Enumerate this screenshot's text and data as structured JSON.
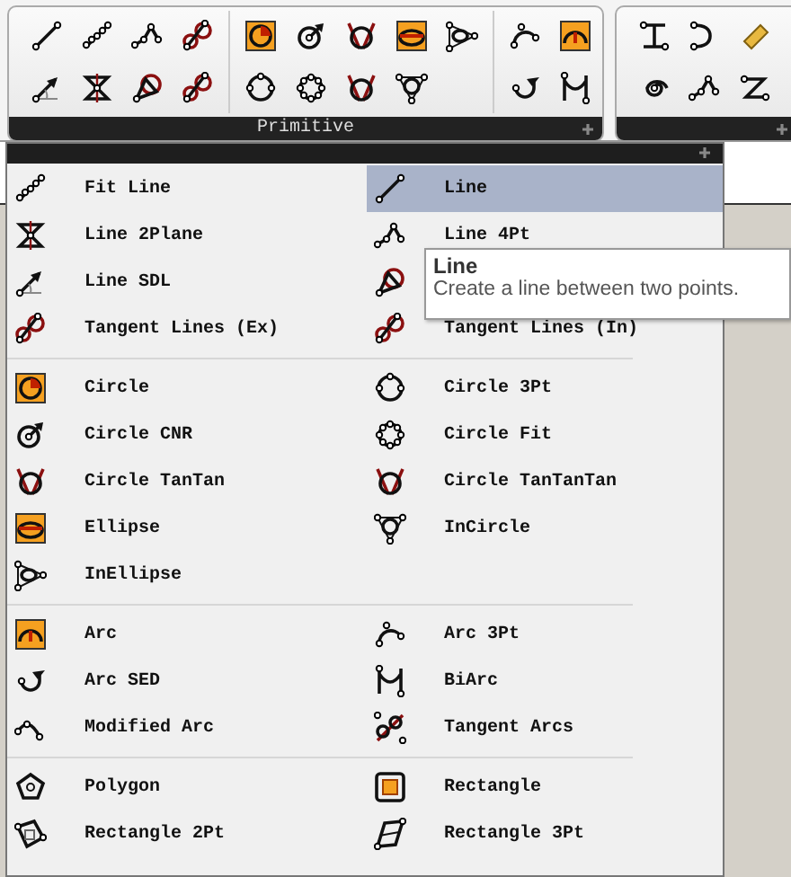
{
  "ribbon": {
    "panels": [
      {
        "title": "Primitive"
      }
    ]
  },
  "menu": {
    "groups": [
      [
        {
          "label": "Fit Line",
          "selected": false
        },
        {
          "label": "Line",
          "selected": true
        },
        {
          "label": "Line 2Plane",
          "selected": false
        },
        {
          "label": "Line 4Pt",
          "selected": false
        },
        {
          "label": "Line SDL",
          "selected": false
        },
        {
          "selected": false
        },
        {
          "label": "Tangent Lines (Ex)",
          "selected": false
        },
        {
          "label": "Tangent Lines (In)",
          "selected": false
        }
      ],
      [
        {
          "label": "Circle",
          "selected": false
        },
        {
          "label": "Circle 3Pt",
          "selected": false
        },
        {
          "label": "Circle CNR",
          "selected": false
        },
        {
          "label": "Circle Fit",
          "selected": false
        },
        {
          "label": "Circle TanTan",
          "selected": false
        },
        {
          "label": "Circle TanTanTan",
          "selected": false
        },
        {
          "label": "Ellipse",
          "selected": false
        },
        {
          "label": "InCircle",
          "selected": false
        },
        {
          "label": "InEllipse",
          "selected": false
        }
      ],
      [
        {
          "label": "Arc",
          "selected": false
        },
        {
          "label": "Arc 3Pt",
          "selected": false
        },
        {
          "label": "Arc SED",
          "selected": false
        },
        {
          "label": "BiArc",
          "selected": false
        },
        {
          "label": "Modified Arc",
          "selected": false
        },
        {
          "label": "Tangent Arcs",
          "selected": false
        }
      ],
      [
        {
          "label": "Polygon",
          "selected": false
        },
        {
          "label": "Rectangle",
          "selected": false
        },
        {
          "label": "Rectangle 2Pt",
          "selected": false
        },
        {
          "label": "Rectangle 3Pt",
          "selected": false
        }
      ]
    ]
  },
  "tooltip": {
    "title": "Line",
    "text": "Create a line between two points."
  }
}
